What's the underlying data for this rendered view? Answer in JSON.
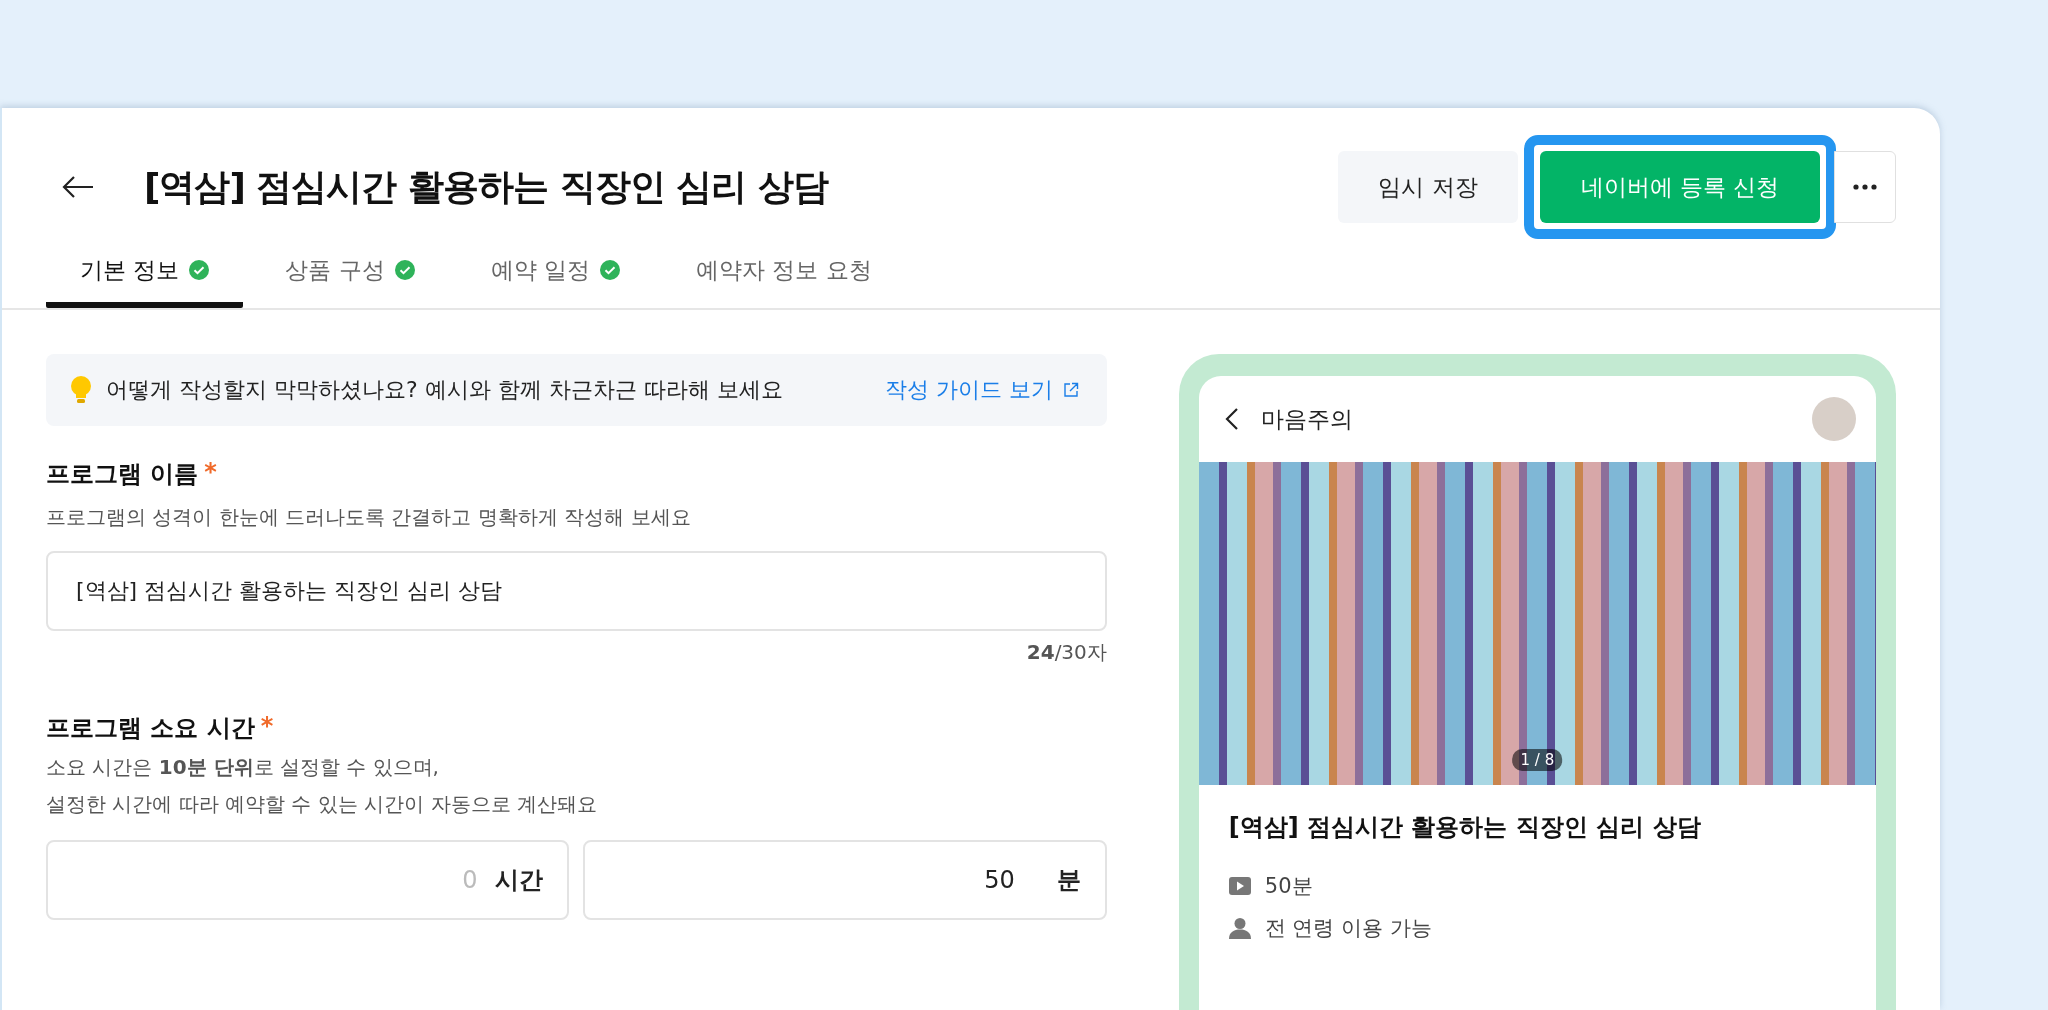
{
  "header": {
    "title": "[역삼] 점심시간 활용하는 직장인 심리 상담"
  },
  "actions": [
    {
      "label": "임시 저장",
      "kind": "secondary",
      "highlighted": false
    },
    {
      "label": "네이버에 등록 신청",
      "kind": "primary",
      "highlighted": true
    }
  ],
  "tabs": [
    {
      "label": "기본 정보",
      "selected": true,
      "completed": true
    },
    {
      "label": "상품 구성",
      "selected": false,
      "completed": true
    },
    {
      "label": "예약 일정",
      "selected": false,
      "completed": true
    },
    {
      "label": "예약자 정보 요청",
      "selected": false,
      "completed": false
    }
  ],
  "hint": {
    "text": "어떻게 작성할지 막막하셨나요? 예시와 함께 차근차근 따라해 보세요",
    "link": "작성 가이드 보기"
  },
  "name_field": {
    "label": "프로그램 이름",
    "required_mark": "*",
    "description": "프로그램의 성격이 한눈에 드러나도록 간결하고 명확하게 작성해 보세요",
    "value": "[역삼] 점심시간 활용하는 직장인 심리 상담",
    "counter": "**24**/30자"
  },
  "duration_field": {
    "label": "프로그램 소요 시간",
    "required_mark": "*",
    "description_lines": [
      "소요 시간은 **10분 단위**로 설정할 수 있으며,",
      "설정한 시간에 따라 예약할 수 있는 시간이 자동으로 계산돼요"
    ],
    "inputs": [
      {
        "placeholder": "0",
        "unit": "시간"
      },
      {
        "value": "50",
        "unit": "분"
      }
    ]
  },
  "preview": {
    "store_name": "마음주의",
    "page_counter": "1 / 8",
    "title": "[역삼] 점심시간 활용하는 직장인 심리 상담",
    "meta": [
      {
        "kind": "duration",
        "text": "50분"
      },
      {
        "kind": "age",
        "text": "전 연령 이용 가능"
      }
    ]
  }
}
